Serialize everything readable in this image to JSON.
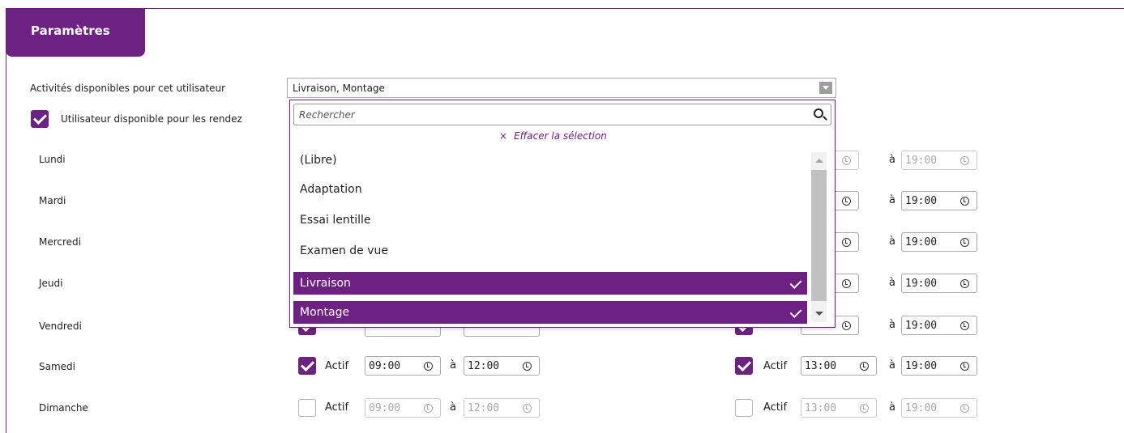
{
  "tab": {
    "title": "Paramètres"
  },
  "activities": {
    "label": "Activités disponibles pour cet utilisateur",
    "value": "Livraison, Montage"
  },
  "availability": {
    "label": "Utilisateur disponible pour les rendez",
    "checked": true
  },
  "dropdown": {
    "search_placeholder": "Rechercher",
    "clear_icon": "×",
    "clear_label": "Effacer la sélection",
    "options": [
      {
        "label": "(Libre)",
        "selected": false
      },
      {
        "label": "Adaptation",
        "selected": false
      },
      {
        "label": "Essai lentille",
        "selected": false
      },
      {
        "label": "Examen de vue",
        "selected": false
      },
      {
        "label": "Livraison",
        "selected": true
      },
      {
        "label": "Montage",
        "selected": true
      }
    ]
  },
  "schedule": {
    "actif_label": "Actif",
    "a_label": "à",
    "days": [
      {
        "name": "Lundi"
      },
      {
        "name": "Mardi"
      },
      {
        "name": "Mercredi"
      },
      {
        "name": "Jeudi"
      },
      {
        "name": "Vendredi"
      },
      {
        "name": "Samedi",
        "am": {
          "active": true,
          "from": "09:00",
          "to": "12:00"
        },
        "pm": {
          "active": true,
          "from": "13:00",
          "to": "19:00"
        }
      },
      {
        "name": "Dimanche",
        "am": {
          "active": false,
          "from": "09:00",
          "to": "12:00"
        },
        "pm": {
          "active": false,
          "from": "13:00",
          "to": "19:00"
        }
      }
    ],
    "visible_to_times": [
      "19:00",
      "19:00",
      "19:00",
      "19:00",
      "19:00"
    ]
  },
  "colors": {
    "accent": "#6d2183"
  }
}
